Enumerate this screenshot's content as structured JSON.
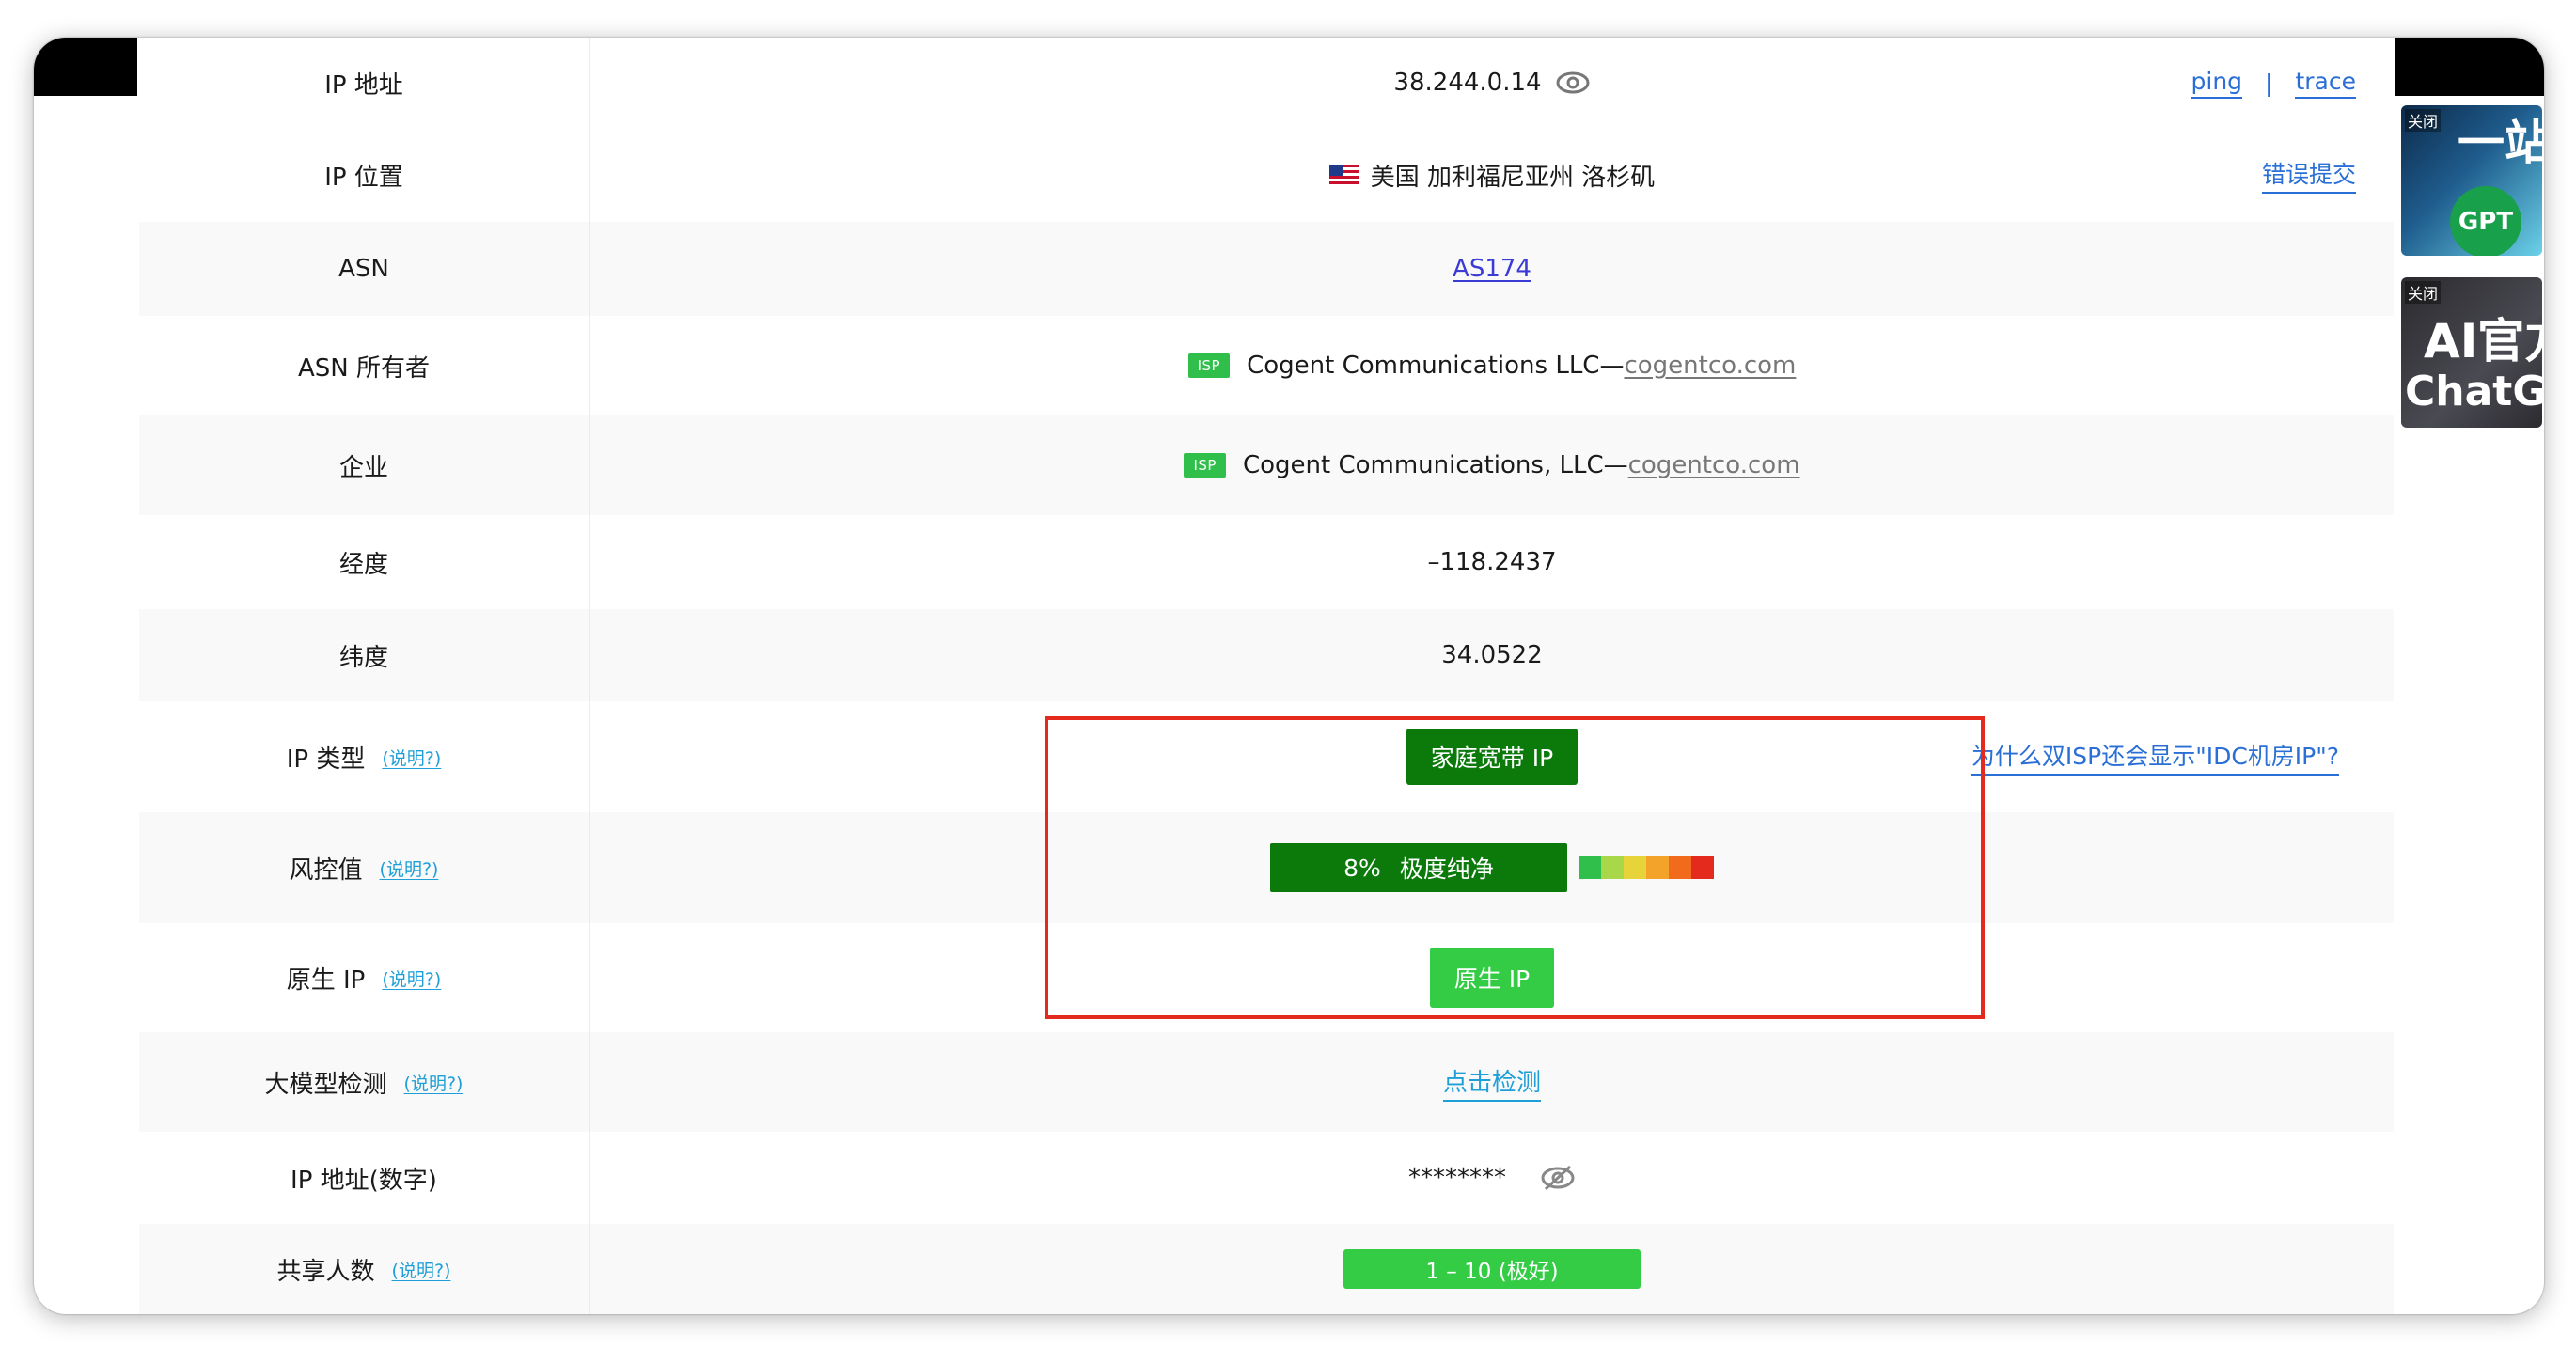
{
  "rows": {
    "ip_address": {
      "label": "IP 地址",
      "value": "38.244.0.14",
      "ping": "ping",
      "separator": "|",
      "trace": "trace"
    },
    "ip_location": {
      "label": "IP 位置",
      "value": "美国 加利福尼亚州 洛杉矶",
      "report": "错误提交"
    },
    "asn": {
      "label": "ASN",
      "value": "AS174"
    },
    "asn_owner": {
      "label": "ASN 所有者",
      "badge": "ISP",
      "value": "Cogent Communications LLC—",
      "domain": "cogentco.com"
    },
    "enterprise": {
      "label": "企业",
      "badge": "ISP",
      "value": "Cogent Communications, LLC—",
      "domain": "cogentco.com"
    },
    "longitude": {
      "label": "经度",
      "value": "–118.2437"
    },
    "latitude": {
      "label": "纬度",
      "value": "34.0522"
    },
    "ip_type": {
      "label": "IP 类型",
      "hint": "(说明?)",
      "value": "家庭宽带 IP",
      "why_link": "为什么双ISP还会显示\"IDC机房IP\"?"
    },
    "risk": {
      "label": "风控值",
      "hint": "(说明?)",
      "percent": "8%",
      "text": "极度纯净",
      "score": 0.08
    },
    "native_ip": {
      "label": "原生 IP",
      "hint": "(说明?)",
      "value": "原生 IP"
    },
    "llm_check": {
      "label": "大模型检测",
      "hint": "(说明?)",
      "value": "点击检测"
    },
    "ip_numeric": {
      "label": "IP 地址(数字)",
      "value": "********"
    },
    "shared_users": {
      "label": "共享人数",
      "hint": "(说明?)",
      "value": "1 – 10 (极好)"
    }
  },
  "risk_scale_colors": [
    "#2fbf4a",
    "#a8d84a",
    "#e6d43a",
    "#f3a22a",
    "#f26a1c",
    "#e42a1d"
  ],
  "colors": {
    "link_blue": "#2a6fd6",
    "hint_blue": "#1e9fd8",
    "badge_dark_green": "#0b7a0b",
    "badge_green": "#33cc44",
    "highlight_red": "#e42a1d"
  },
  "ads": [
    {
      "close": "关闭",
      "headline": "一站式",
      "badge": "GPT"
    },
    {
      "close": "关闭",
      "line1": "AI官方",
      "line2": "ChatGPT"
    }
  ]
}
